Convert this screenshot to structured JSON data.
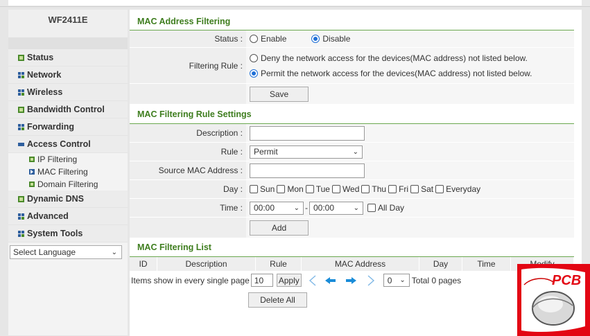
{
  "model": "WF2411E",
  "nav": {
    "status": "Status",
    "network": "Network",
    "wireless": "Wireless",
    "bandwidth": "Bandwidth Control",
    "forwarding": "Forwarding",
    "access_control": "Access Control",
    "sub_ip": "IP Filtering",
    "sub_mac": "MAC Filtering",
    "sub_domain": "Domain Filtering",
    "ddns": "Dynamic DNS",
    "advanced": "Advanced",
    "system_tools": "System Tools"
  },
  "language": {
    "selected": "Select Language"
  },
  "mac_filtering": {
    "title": "MAC Address Filtering",
    "status_label": "Status :",
    "enable": "Enable",
    "disable": "Disable",
    "status_value": "Disable",
    "rule_label": "Filtering Rule :",
    "deny_text": "Deny the network access for the devices(MAC address) not listed below.",
    "permit_text": "Permit the network access for the devices(MAC address) not listed below.",
    "rule_value": "permit",
    "save": "Save"
  },
  "rule_settings": {
    "title": "MAC Filtering Rule Settings",
    "description_label": "Description :",
    "rule_label": "Rule :",
    "rule_value": "Permit",
    "source_mac_label": "Source MAC Address :",
    "day_label": "Day :",
    "days": [
      "Sun",
      "Mon",
      "Tue",
      "Wed",
      "Thu",
      "Fri",
      "Sat",
      "Everyday"
    ],
    "time_label": "Time :",
    "time_start": "00:00",
    "time_sep": "-",
    "time_end": "00:00",
    "all_day": "All Day",
    "add": "Add"
  },
  "list": {
    "title": "MAC Filtering List",
    "columns": [
      "ID",
      "Description",
      "Rule",
      "MAC Address",
      "Day",
      "Time",
      "Modify"
    ],
    "items_label": "Items show in every single page",
    "items_value": "10",
    "apply": "Apply",
    "page_value": "0",
    "total": "Total 0 pages",
    "delete_all": "Delete All"
  },
  "watermark": {
    "text": "PCB"
  },
  "colors": {
    "section_title": "#3e7d1e",
    "radio_accent": "#1f6fd6",
    "watermark": "#e30613"
  }
}
